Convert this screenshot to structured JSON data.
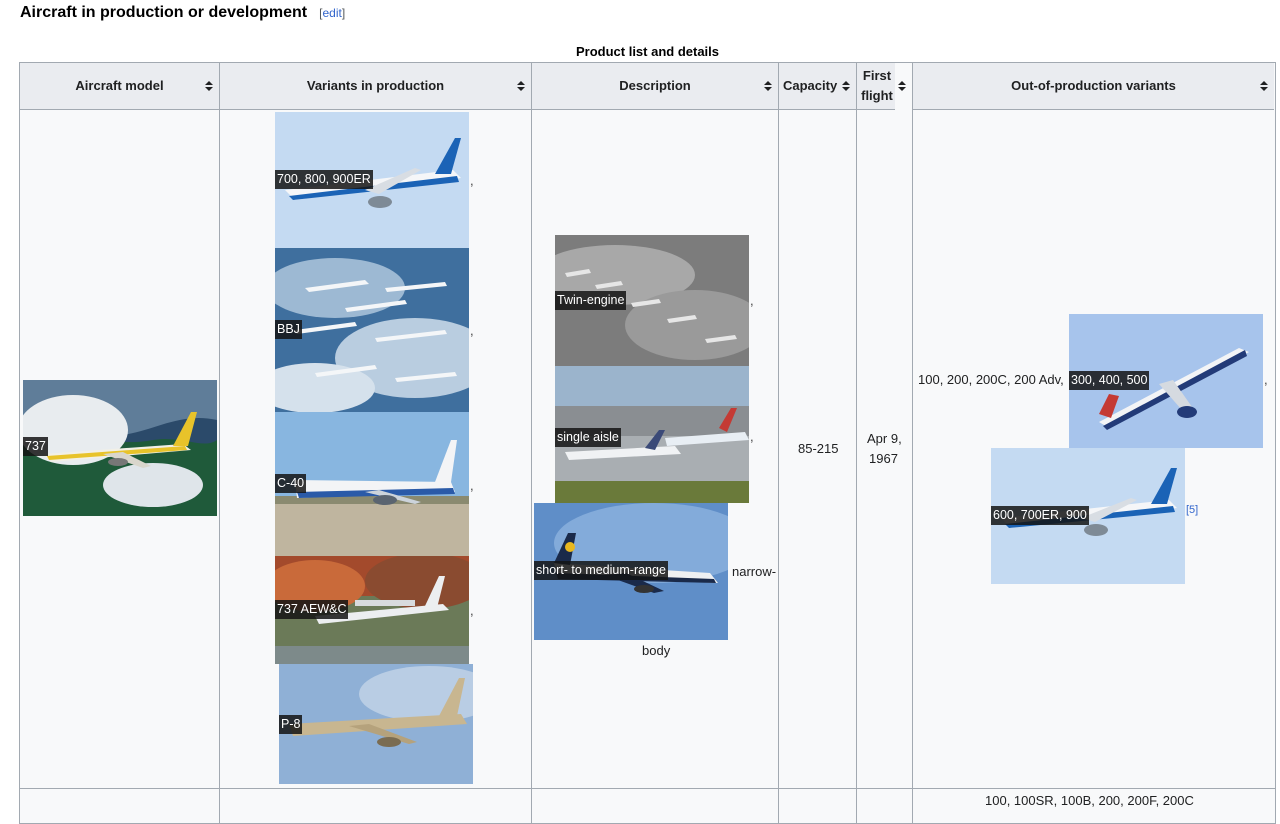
{
  "section": {
    "title": "Aircraft in production or development",
    "edit_link": "edit",
    "bracket_open": "[",
    "bracket_close": "]"
  },
  "table": {
    "caption": "Product list and details",
    "headers": {
      "model": "Aircraft model",
      "variants": "Variants in production",
      "description": "Description",
      "capacity": "Capacity",
      "first_flight": "First flight",
      "out_of_production": "Out-of-production variants"
    },
    "row": {
      "model": "737",
      "variants": [
        "700, 800, 900ER",
        "BBJ",
        "C-40",
        "737 AEW&C",
        "P-8"
      ],
      "description": {
        "tags": [
          "Twin-engine",
          "single aisle",
          "short- to medium-range"
        ],
        "trail_1": "narrow-",
        "trail_2": "body"
      },
      "capacity": "85-215",
      "first_flight_1": "Apr 9,",
      "first_flight_2": "1967",
      "out_of_production": {
        "prefix": "100, 200, 200C, 200 Adv,",
        "tag_1": "300, 400, 500",
        "tag_2": "600, 700ER, 900",
        "ref": "[5]"
      }
    },
    "next_row_partial": "100, 100SR, 100B, 200, 200F, 200C"
  },
  "colors": {
    "link": "#3366cc",
    "header_bg": "#eaecf0",
    "row_bg": "#f8f9fa",
    "border": "#a2a9b1"
  }
}
